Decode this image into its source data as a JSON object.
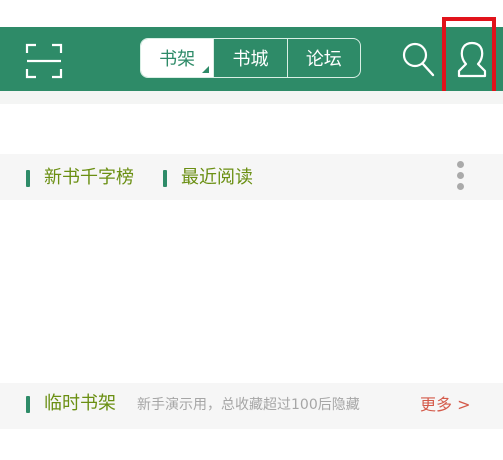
{
  "topbar": {
    "color": "#2e8b68",
    "scan_icon": "scan-icon",
    "tabs": [
      {
        "label": "书架",
        "active": true
      },
      {
        "label": "书城",
        "active": false
      },
      {
        "label": "论坛",
        "active": false
      }
    ],
    "search_icon": "search-icon",
    "profile_icon": "user-avatar-icon",
    "highlight_color": "#e1131b"
  },
  "sections": {
    "rank_label": "新书千字榜",
    "recent_label": "最近阅读",
    "more_menu_icon": "vertical-dots-icon",
    "temp_shelf_label": "临时书架",
    "temp_shelf_hint": "新手演示用，总收藏超过100后隐藏",
    "more_link": "更多 >"
  },
  "colors": {
    "label_green": "#6a8f12",
    "more_red": "#d45a4a"
  }
}
